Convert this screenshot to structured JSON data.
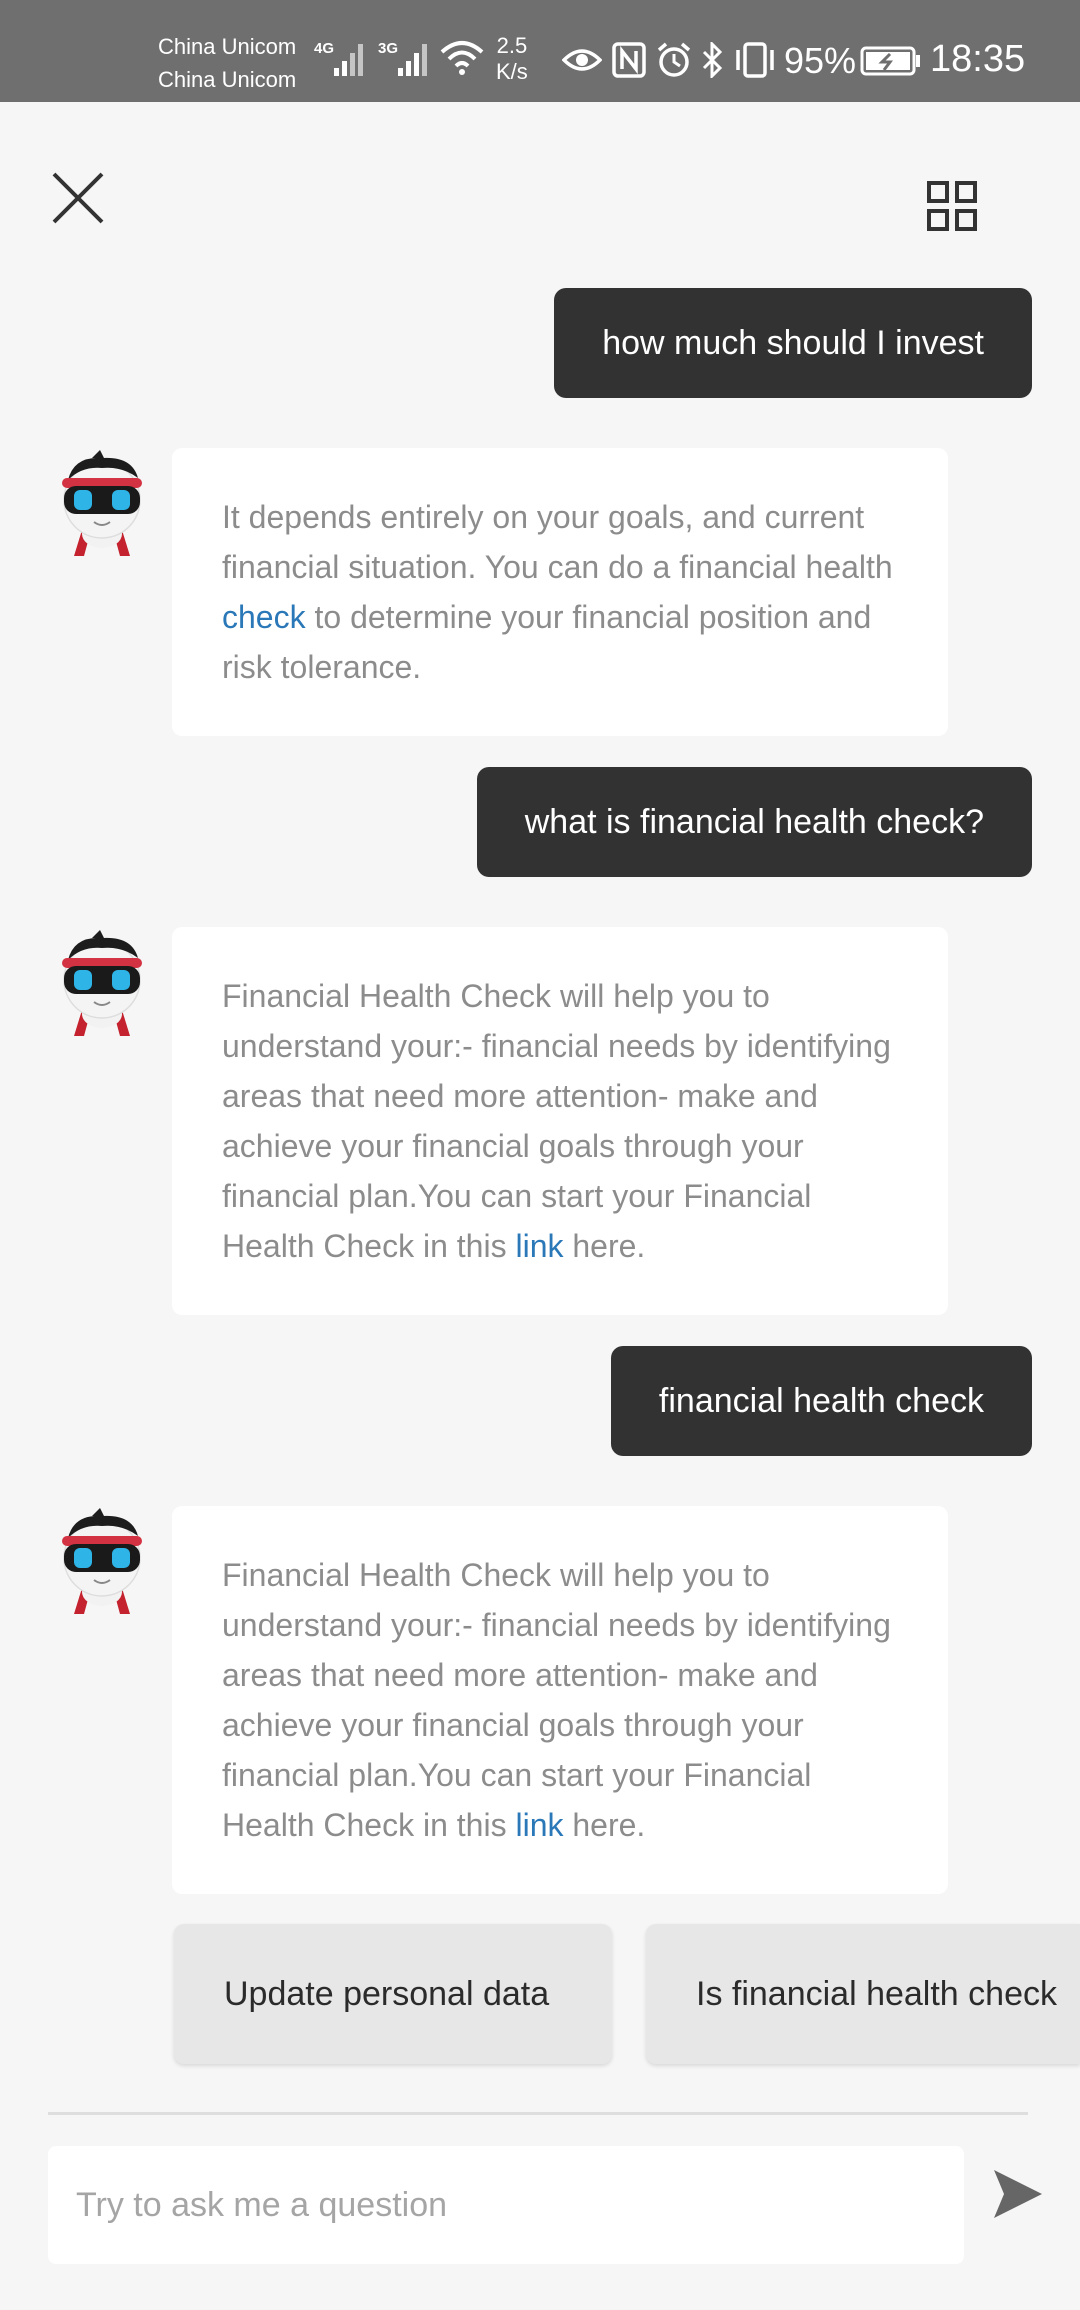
{
  "status_bar": {
    "carrier1": "China Unicom",
    "carrier2": "China Unicom",
    "net1": "4G",
    "net2": "3G",
    "speed_value": "2.5",
    "speed_unit": "K/s",
    "battery": "95%",
    "time": "18:35"
  },
  "chat": [
    {
      "role": "user",
      "text": "how much should I invest"
    },
    {
      "role": "bot",
      "parts": [
        "It depends entirely on your goals, and current financial situation. You can do a financial health ",
        "check",
        " to determine your financial position and risk tolerance."
      ]
    },
    {
      "role": "user",
      "text": "what is financial health check?"
    },
    {
      "role": "bot",
      "parts": [
        "Financial Health Check will help you to understand your:- financial needs by identifying areas that need more attention- make and achieve your financial goals through your financial plan.You can start your Financial Health Check in this ",
        "link",
        " here."
      ]
    },
    {
      "role": "user",
      "text": "financial health check"
    },
    {
      "role": "bot",
      "parts": [
        "Financial Health Check will help you to understand your:- financial needs by identifying areas that need more attention- make and achieve your financial goals through your financial plan.You can start your Financial Health Check in this ",
        "link",
        " here."
      ]
    }
  ],
  "suggestions": [
    "Update personal data",
    "Is financial health check"
  ],
  "input": {
    "placeholder": "Try to ask me a question"
  },
  "icons": {
    "close": "close-icon",
    "menu": "grid-icon",
    "send": "send-icon",
    "avatar": "robot-avatar"
  },
  "colors": {
    "user_bubble": "#323232",
    "link": "#2a78b8",
    "status_bar": "#6f6f6f"
  }
}
